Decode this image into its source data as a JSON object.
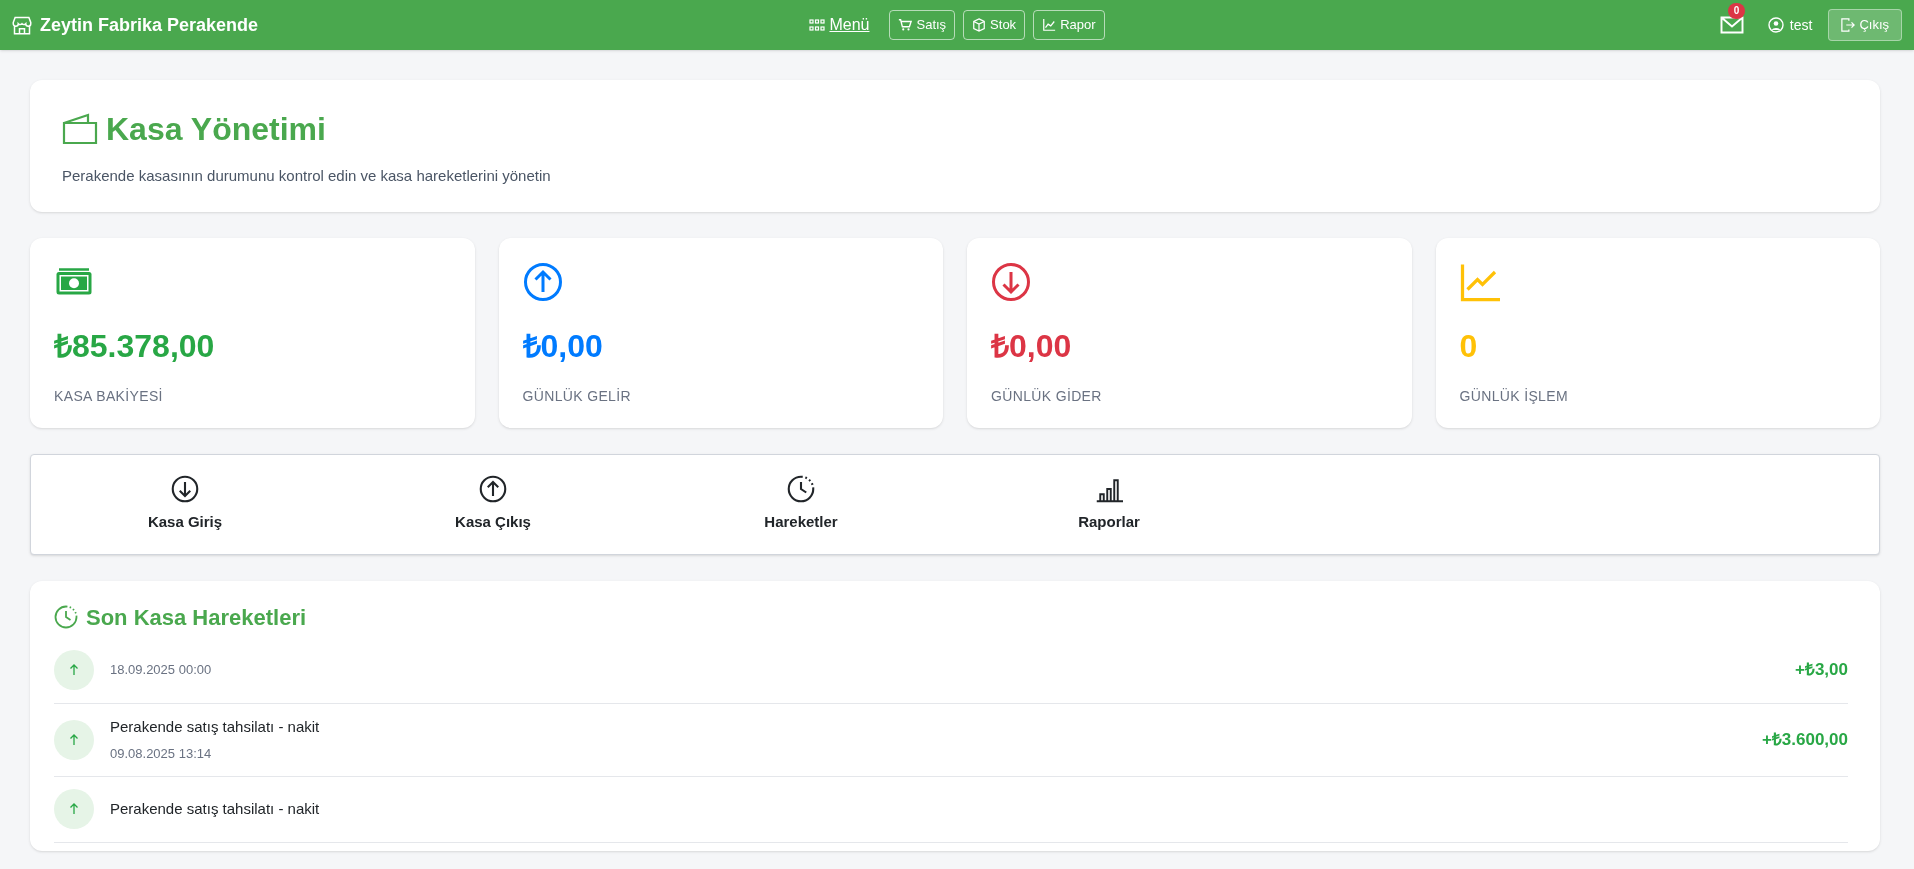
{
  "navbar": {
    "brand": "Zeytin Fabrika Perakende",
    "menu_link": "Menü",
    "nav_buttons": [
      {
        "kind": "cart",
        "label": "Satış"
      },
      {
        "kind": "box",
        "label": "Stok"
      },
      {
        "kind": "chart",
        "label": "Rapor"
      }
    ],
    "message_count": "0",
    "user": "test",
    "logout": "Çıkış"
  },
  "header": {
    "title": "Kasa Yönetimi",
    "subtitle": "Perakende kasasının durumunu kontrol edin ve kasa hareketlerini yönetin"
  },
  "stats": [
    {
      "kind": "cash",
      "value": "₺85.378,00",
      "label": "KASA BAKİYESİ",
      "color": "#28a745"
    },
    {
      "kind": "up",
      "value": "₺0,00",
      "label": "GÜNLÜK GELİR",
      "color": "#007bff"
    },
    {
      "kind": "down",
      "value": "₺0,00",
      "label": "GÜNLÜK GİDER",
      "color": "#dc3545"
    },
    {
      "kind": "trend",
      "value": "0",
      "label": "GÜNLÜK İŞLEM",
      "color": "#ffc107"
    }
  ],
  "actions": [
    {
      "kind": "down",
      "label": "Kasa Giriş"
    },
    {
      "kind": "up",
      "label": "Kasa Çıkış"
    },
    {
      "kind": "history",
      "label": "Hareketler"
    },
    {
      "kind": "bars",
      "label": "Raporlar"
    }
  ],
  "recent": {
    "title": "Son Kasa Hareketleri",
    "items": [
      {
        "kind": "in",
        "date": "18.09.2025 00:00",
        "amount": "+₺3,00"
      },
      {
        "kind": "in",
        "description": "Perakende satış tahsilatı - nakit",
        "date": "09.08.2025 13:14",
        "amount": "+₺3.600,00"
      },
      {
        "kind": "in",
        "description": "Perakende satış tahsilatı - nakit"
      }
    ]
  }
}
